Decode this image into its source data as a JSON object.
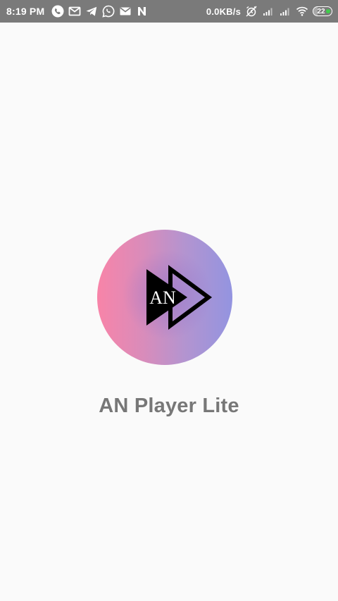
{
  "status_bar": {
    "time": "8:19 PM",
    "net_speed": "0.0KB/s",
    "battery_level": "22",
    "battery_fraction": 0.22,
    "left_icons": [
      "phone-icon",
      "gmail-icon",
      "telegram-icon",
      "whatsapp-icon",
      "gmail-icon",
      "n-app-icon"
    ],
    "right_icons": [
      "alarm-off-icon",
      "signal-icon",
      "signal-icon",
      "wifi-icon",
      "battery-icon"
    ],
    "background_color": "#7a7a7a"
  },
  "splash": {
    "logo_text": "AN",
    "app_name": "AN Player Lite",
    "title_color": "#777777",
    "logo_gradient": [
      "#f884a8",
      "#9394e0"
    ]
  }
}
